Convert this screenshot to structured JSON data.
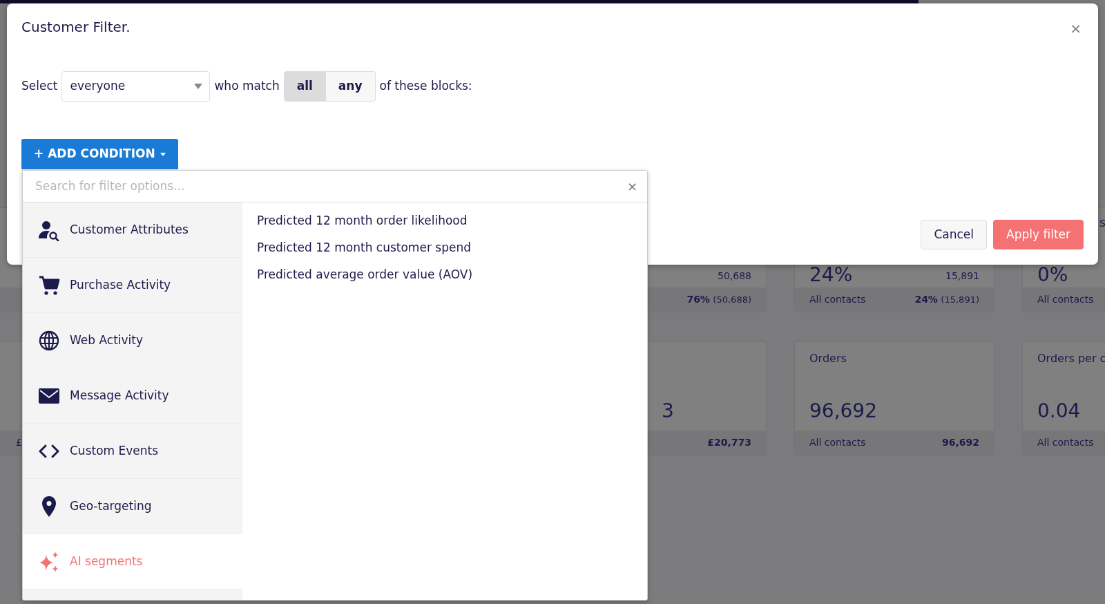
{
  "background": {
    "left_fragment": "£",
    "right_fragment": "s",
    "row_1": [
      {
        "secondary": "50,688",
        "footer_value": "76%",
        "footer_note": "(50,688)"
      },
      {
        "value": "24%",
        "secondary": "15,891",
        "footer_label": "All contacts",
        "footer_value": "24%",
        "footer_note": "(15,891)"
      },
      {
        "value": "0%",
        "footer_label": "All contacts"
      }
    ],
    "row_2": [
      {
        "value": "3",
        "footer_value": "£20,773"
      },
      {
        "title": "Orders",
        "value": "96,692",
        "footer_label": "All contacts",
        "footer_value": "96,692"
      },
      {
        "title": "Orders per c",
        "value": "0.04",
        "footer_label": "All contacts"
      }
    ]
  },
  "modal": {
    "title": "Customer Filter.",
    "close": "×",
    "select_label": "Select",
    "audience": {
      "value": "everyone"
    },
    "match_label": "who match",
    "match_options": [
      {
        "label": "all",
        "selected": true
      },
      {
        "label": "any",
        "selected": false
      }
    ],
    "blocks_label": "of these blocks:",
    "add_condition": {
      "label": "+ ADD CONDITION",
      "expanded": true
    },
    "buttons": [
      {
        "label": "Cancel",
        "kind": "secondary"
      },
      {
        "label": "Apply filter",
        "kind": "primary"
      }
    ]
  },
  "filter_menu": {
    "search": {
      "placeholder": "Search for filter options..."
    },
    "clear": "×",
    "categories": [
      {
        "label": "Customer Attributes",
        "selected": false
      },
      {
        "label": "Purchase Activity",
        "selected": false
      },
      {
        "label": "Web Activity",
        "selected": false
      },
      {
        "label": "Message Activity",
        "selected": false
      },
      {
        "label": "Custom Events",
        "selected": false
      },
      {
        "label": "Geo-targeting",
        "selected": false
      },
      {
        "label": "AI segments",
        "selected": true
      }
    ],
    "options": [
      "Predicted 12 month order likelihood",
      "Predicted 12 month customer spend",
      "Predicted average order value (AOV)"
    ]
  }
}
